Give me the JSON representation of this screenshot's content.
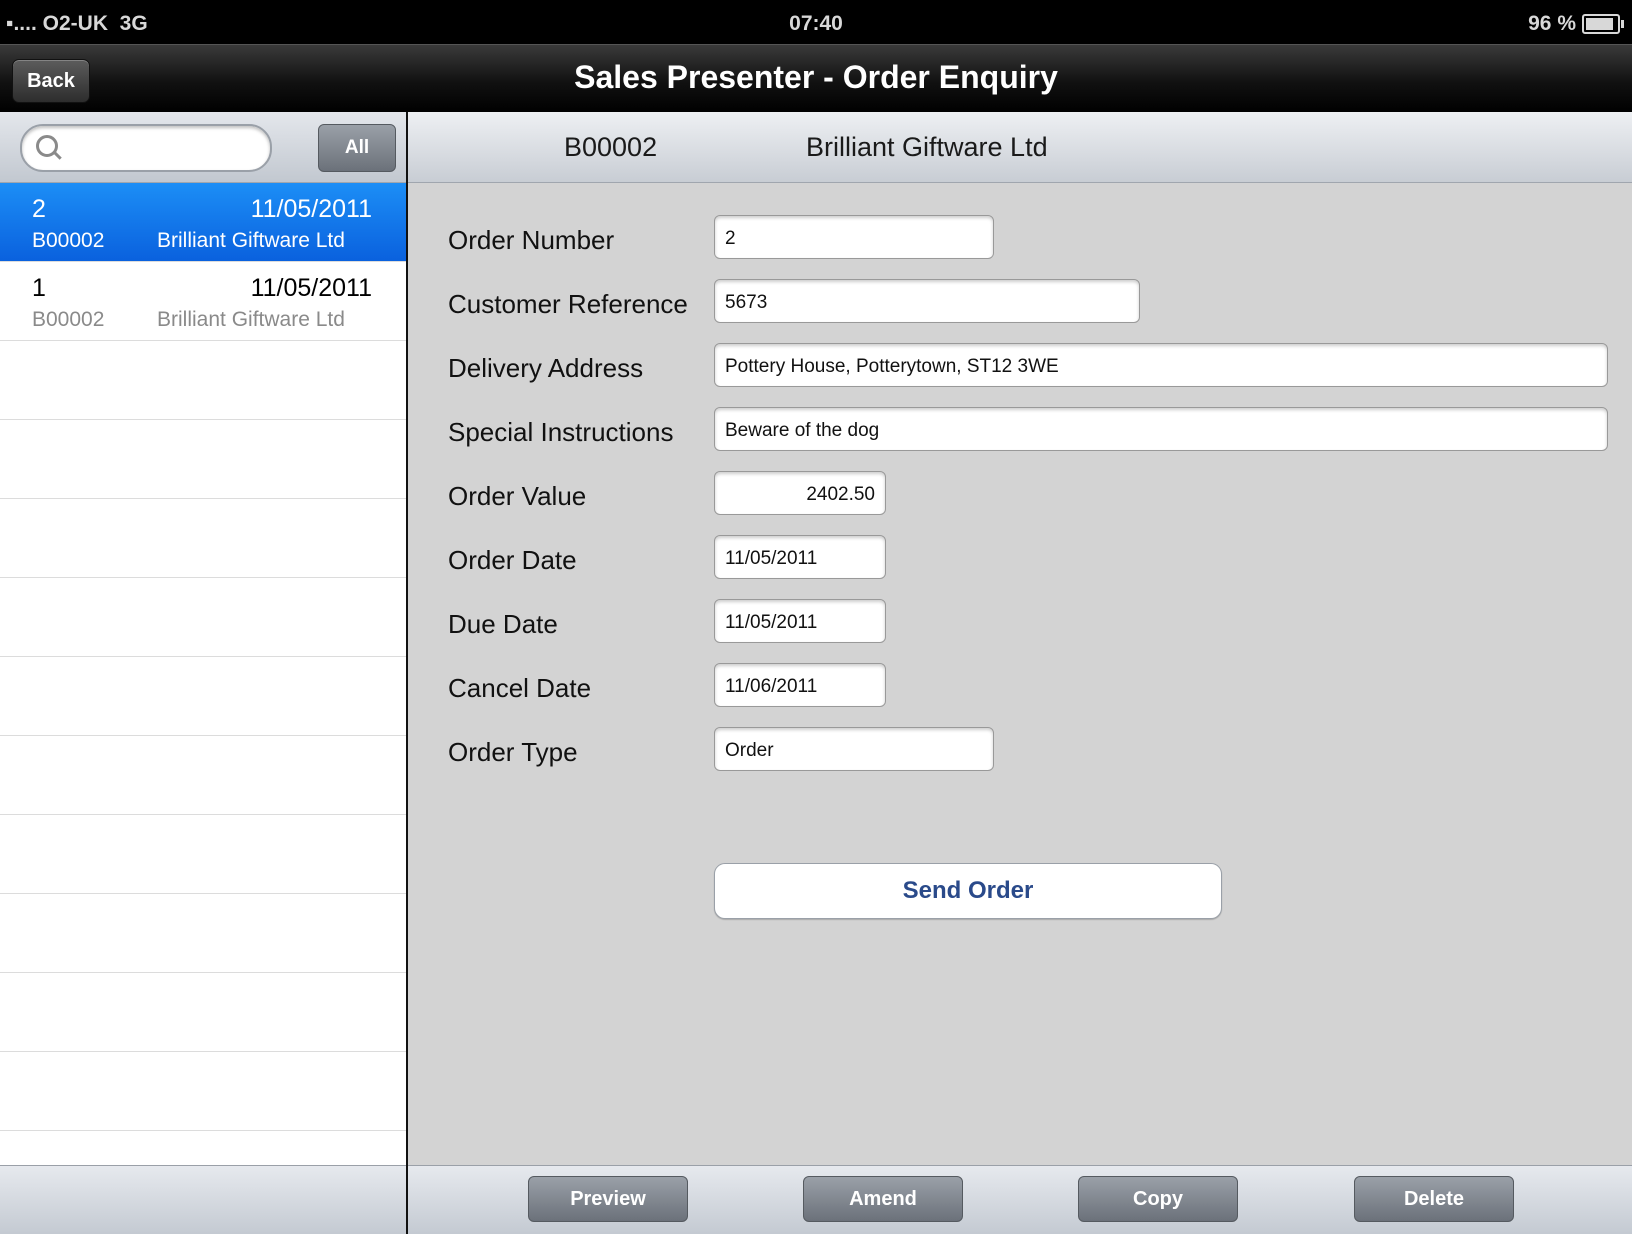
{
  "status_bar": {
    "carrier": "O2-UK",
    "network": "3G",
    "time": "07:40",
    "battery": "96 %",
    "battery_level": 0.96,
    "icons": [
      "signal-dots-icon",
      "battery-icon"
    ]
  },
  "nav": {
    "back_label": "Back",
    "title": "Sales Presenter - Order Enquiry"
  },
  "sidebar": {
    "search_placeholder": "",
    "all_label": "All",
    "orders": [
      {
        "number": "2",
        "date": "11/05/2011",
        "code": "B00002",
        "name": "Brilliant Giftware Ltd",
        "selected": true
      },
      {
        "number": "1",
        "date": "11/05/2011",
        "code": "B00002",
        "name": "Brilliant Giftware Ltd",
        "selected": false
      }
    ]
  },
  "detail": {
    "header_code": "B00002",
    "header_name": "Brilliant Giftware Ltd",
    "fields": [
      {
        "label": "Order Number",
        "value": "2"
      },
      {
        "label": "Customer Reference",
        "value": "5673"
      },
      {
        "label": "Delivery Address",
        "value": "Pottery House, Potterytown, ST12 3WE"
      },
      {
        "label": "Special Instructions",
        "value": "Beware of the dog"
      },
      {
        "label": "Order Value",
        "value": "2402.50"
      },
      {
        "label": "Order Date",
        "value": "11/05/2011"
      },
      {
        "label": "Due Date",
        "value": "11/05/2011"
      },
      {
        "label": "Cancel Date",
        "value": "11/06/2011"
      },
      {
        "label": "Order Type",
        "value": "Order"
      }
    ],
    "send_order_label": "Send Order"
  },
  "toolbar": {
    "preview_label": "Preview",
    "amend_label": "Amend",
    "copy_label": "Copy",
    "delete_label": "Delete"
  },
  "colors": {
    "selection_blue": "#0a61de",
    "send_text": "#2a4a8a",
    "panel_gray": "#d3d3d3"
  }
}
